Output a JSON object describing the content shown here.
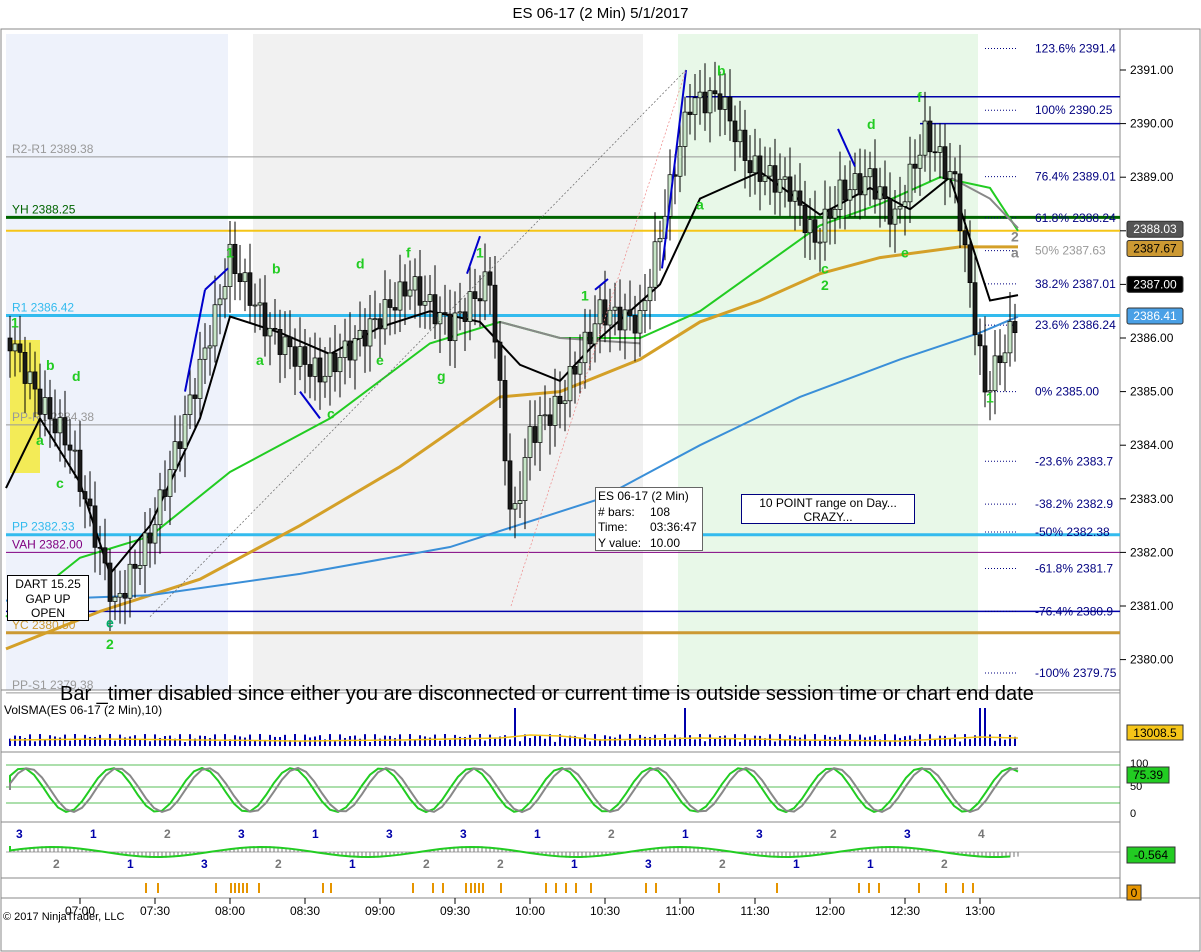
{
  "window": {
    "title": "ES 06-17 (2 Min)  5/1/2017"
  },
  "chart_data": {
    "type": "candlestick",
    "symbol": "ES 06-17 (2 Min)",
    "date": "5/1/2017",
    "y_range": [
      2379.4,
      2391.4
    ],
    "y_ticks": [
      "2391.00",
      "2390.00",
      "2389.00",
      "2388.00",
      "2387.00",
      "2386.00",
      "2385.00",
      "2384.00",
      "2383.00",
      "2382.00",
      "2381.00",
      "2380.00"
    ],
    "x_ticks": [
      "07:00",
      "07:30",
      "08:00",
      "08:30",
      "09:00",
      "09:30",
      "10:00",
      "10:30",
      "11:00",
      "11:30",
      "12:00",
      "12:30",
      "13:00"
    ],
    "price_levels": [
      {
        "label": "R2-R1 2389.38",
        "value": 2389.38,
        "color": "#999999"
      },
      {
        "label": "YH 2388.25",
        "value": 2388.25,
        "color": "#006400"
      },
      {
        "label": "R1 2386.42",
        "value": 2386.42,
        "color": "#33bbee"
      },
      {
        "label": "PP-R1 2384.38",
        "value": 2384.38,
        "color": "#999999"
      },
      {
        "label": "PP 2382.33",
        "value": 2382.33,
        "color": "#33bbee"
      },
      {
        "label": "VAH 2382.00",
        "value": 2382.0,
        "color": "#800080"
      },
      {
        "label": "YC 2380.50",
        "value": 2380.5,
        "color": "#cc9933"
      },
      {
        "label": "PP-S1 2379.38",
        "value": 2379.38,
        "color": "#999999"
      }
    ],
    "fibonacci": [
      {
        "label": "123.6%  2391.4",
        "value": 2391.4
      },
      {
        "label": "100%  2390.25",
        "value": 2390.25
      },
      {
        "label": "76.4%  2389.01",
        "value": 2389.01
      },
      {
        "label": "61.8%  2388.24",
        "value": 2388.24
      },
      {
        "label": "50%  2387.63",
        "value": 2387.63
      },
      {
        "label": "38.2%  2387.01",
        "value": 2387.01
      },
      {
        "label": "23.6%  2386.24",
        "value": 2386.24
      },
      {
        "label": "0%  2385.00",
        "value": 2385.0
      },
      {
        "label": "-23.6%  2383.7",
        "value": 2383.7
      },
      {
        "label": "-38.2%  2382.9",
        "value": 2382.9
      },
      {
        "label": "-50%  2382.38",
        "value": 2382.38
      },
      {
        "label": "-61.8%  2381.7",
        "value": 2381.7
      },
      {
        "label": "-76.4%  2380.9",
        "value": 2380.9
      },
      {
        "label": "-100%  2379.75",
        "value": 2379.75
      }
    ],
    "price_tags": [
      {
        "label": "2388.03",
        "value": 2388.03,
        "bg": "#555555",
        "fg": "#ffffff"
      },
      {
        "label": "2387.67",
        "value": 2387.67,
        "bg": "#cc9933",
        "fg": "#000000"
      },
      {
        "label": "2387.00",
        "value": 2387.0,
        "bg": "#000000",
        "fg": "#ffffff"
      },
      {
        "label": "2386.41",
        "value": 2386.41,
        "bg": "#4aa0e6",
        "fg": "#ffffff"
      }
    ],
    "info_box": {
      "instrument": "ES 06-17 (2 Min)",
      "bars_label": "# bars:",
      "bars": "108",
      "time_label": "Time:",
      "time": "03:36:47",
      "y_label": "Y value:",
      "y_value": "10.00"
    },
    "annotations": {
      "note_line1": "10 POINT range on Day...",
      "note_line2": "CRAZY...",
      "dart_line1": "DART 15.25",
      "dart_line2": "GAP UP",
      "dart_line3": "OPEN",
      "bar_timer_message": "Bar _timer disabled since either you are disconnected or current time is outside session time or chart end date"
    },
    "wave_labels": [
      "1",
      "a",
      "b",
      "c",
      "d",
      "e",
      "2",
      "1",
      "a",
      "b",
      "c",
      "d",
      "e",
      "f",
      "g",
      "1",
      "1",
      "a",
      "b",
      "c",
      "d",
      "e",
      "2",
      "f",
      "1",
      "2",
      "a"
    ],
    "volume_panel": {
      "label": "VolSMA(ES 06-17 (2 Min),10)",
      "last": "13008.5"
    },
    "stoch_panel": {
      "ticks": [
        "100",
        "50",
        "0"
      ],
      "last": "75.39"
    },
    "macd_panel": {
      "last": "-0.564",
      "labels": [
        "3",
        "2",
        "1",
        "1",
        "2",
        "3",
        "3",
        "2",
        "1",
        "1",
        "3",
        "2",
        "3",
        "2",
        "1",
        "1",
        "2",
        "3",
        "1",
        "2",
        "3",
        "1",
        "2",
        "1",
        "3",
        "2",
        "4"
      ]
    },
    "bottom_panel": {
      "last": "0"
    },
    "copyright": "© 2017 NinjaTrader, LLC"
  }
}
